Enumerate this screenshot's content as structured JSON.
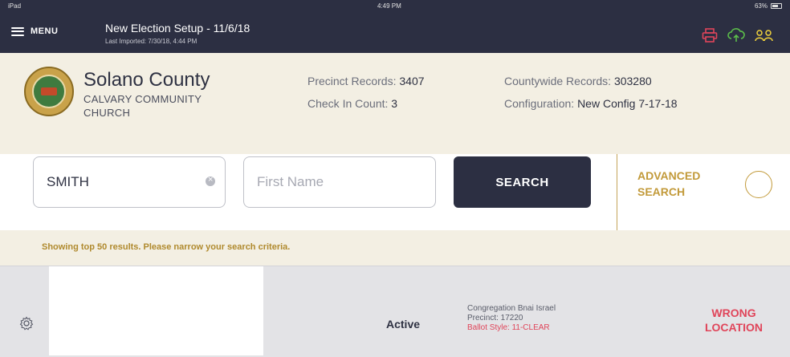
{
  "status_bar": {
    "device": "iPad",
    "time": "4:49 PM",
    "battery": "63%"
  },
  "header": {
    "menu_label": "MENU",
    "election_title": "New Election Setup - 11/6/18",
    "last_imported": "Last Imported: 7/30/18, 4:44 PM",
    "icons": [
      "printer-icon",
      "cloud-sync-icon",
      "users-icon"
    ],
    "colors": {
      "background": "#2c2f42",
      "printer": "#e0455a",
      "cloud": "#5cbf4a",
      "users": "#f0d23c"
    }
  },
  "location": {
    "county": "Solano County",
    "site": "CALVARY COMMUNITY CHURCH",
    "seal_icon": "county-seal-icon"
  },
  "stats": {
    "precinct_label": "Precinct Records:",
    "precinct_value": "3407",
    "checkin_label": "Check In Count:",
    "checkin_value": "3",
    "countywide_label": "Countywide Records:",
    "countywide_value": "303280",
    "config_label": "Configuration:",
    "config_value": "New Config 7-17-18"
  },
  "search": {
    "last_name_value": "SMITH",
    "first_name_placeholder": "First Name",
    "button_label": "SEARCH",
    "advanced_label": "ADVANCED SEARCH"
  },
  "notice": "Showing top 50 results. Please narrow your search criteria.",
  "results": [
    {
      "status": "Active",
      "polling_place": "Congregation Bnai Israel",
      "precinct": "Precinct: 17220",
      "ballot_style": "Ballot Style: 11-CLEAR",
      "action": "WRONG LOCATION",
      "action_color": "#e0455a"
    }
  ]
}
